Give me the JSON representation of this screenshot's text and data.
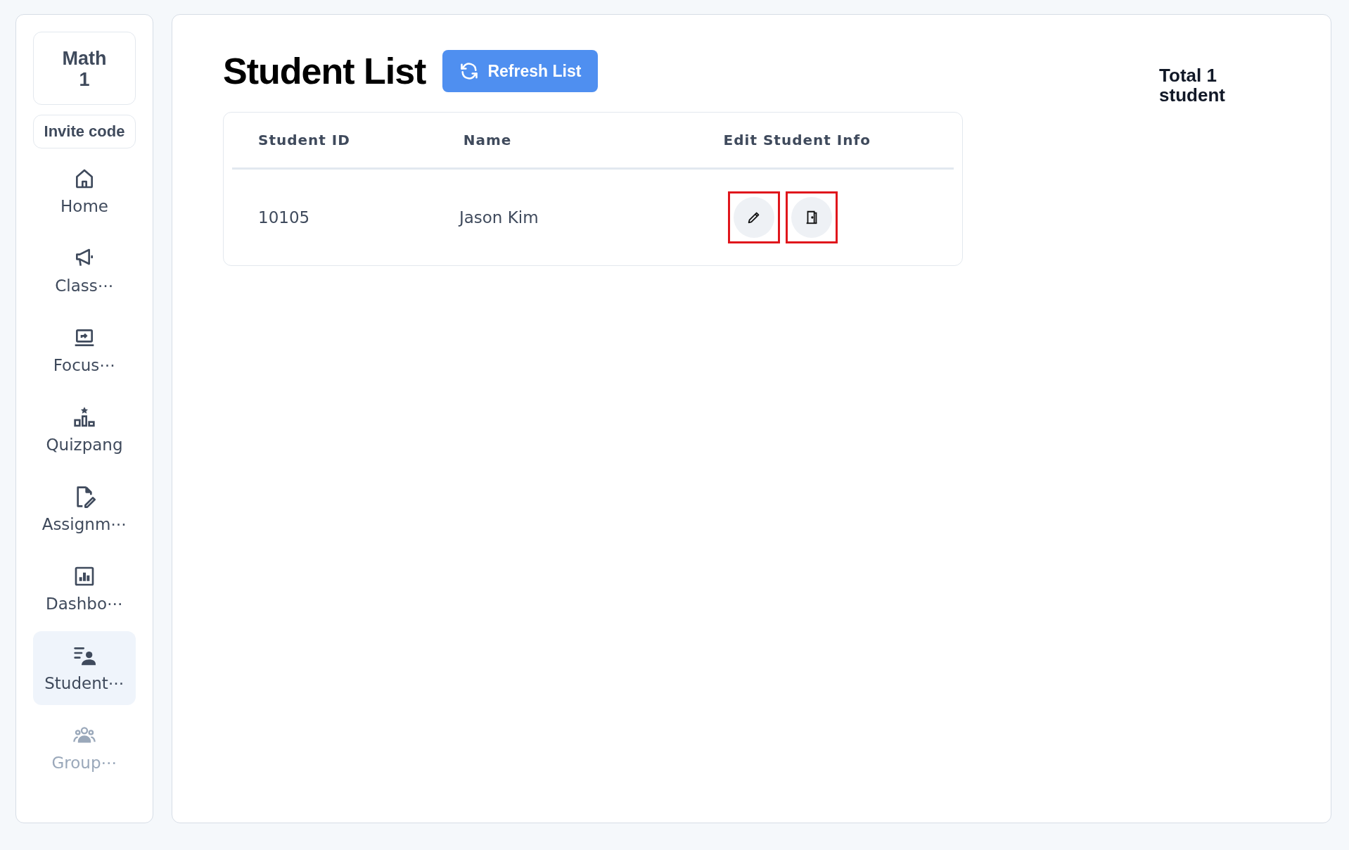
{
  "sidebar": {
    "class_name": "Math\n1",
    "invite_button": "Invite code",
    "items": [
      {
        "kind": "home",
        "label": "Home",
        "selected": false,
        "disabled": false
      },
      {
        "kind": "megaphone",
        "label": "Class⋯",
        "selected": false,
        "disabled": false
      },
      {
        "kind": "laptop",
        "label": "Focus⋯",
        "selected": false,
        "disabled": false
      },
      {
        "kind": "podium",
        "label": "Quizpang",
        "selected": false,
        "disabled": false
      },
      {
        "kind": "docedit",
        "label": "Assignm⋯",
        "selected": false,
        "disabled": false
      },
      {
        "kind": "chart",
        "label": "Dashbo⋯",
        "selected": false,
        "disabled": false
      },
      {
        "kind": "students",
        "label": "Student⋯",
        "selected": true,
        "disabled": false
      },
      {
        "kind": "group",
        "label": "Group⋯",
        "selected": false,
        "disabled": true
      }
    ]
  },
  "header": {
    "title": "Student List",
    "refresh_button": "Refresh List",
    "total": "Total 1\nstudent"
  },
  "table": {
    "columns": [
      "Student ID",
      "Name",
      "Edit Student Info"
    ],
    "rows": [
      {
        "student_id": "10105",
        "name": "Jason Kim",
        "actions": [
          {
            "kind": "edit",
            "highlighted": true
          },
          {
            "kind": "exit",
            "highlighted": true
          }
        ]
      }
    ]
  }
}
